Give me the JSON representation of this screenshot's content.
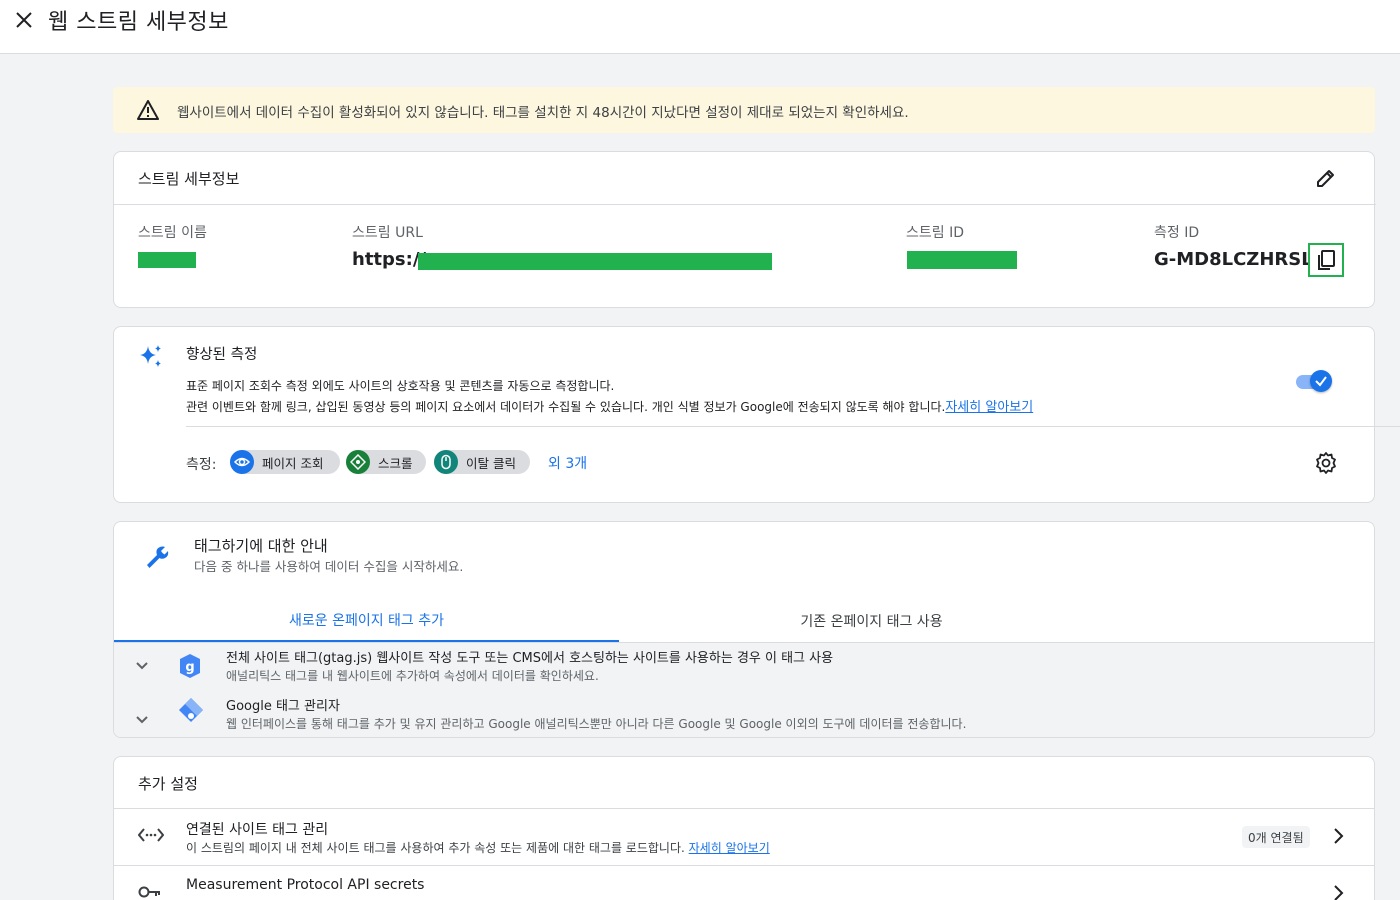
{
  "header": {
    "title": "웹 스트림 세부정보",
    "close_icon": "close-icon"
  },
  "warning": {
    "text": "웹사이트에서 데이터 수집이 활성화되어 있지 않습니다. 태그를 설치한 지 48시간이 지났다면 설정이 제대로 되었는지 확인하세요.",
    "icon": "warning-icon",
    "bg_color": "#fef7e0"
  },
  "stream_details": {
    "title": "스트림 세부정보",
    "name_label": "스트림 이름",
    "url_label": "스트림 URL",
    "url_prefix": "https://",
    "id_label": "스트림 ID",
    "measurement_label": "측정 ID",
    "measurement_id": "G-MD8LCZHRSL",
    "redaction_color": "#21b14e"
  },
  "enhanced": {
    "title": "향상된 측정",
    "desc1": "표준 페이지 조회수 측정 외에도 사이트의 상호작용 및 콘텐츠를 자동으로 측정합니다.",
    "desc2": "관련 이벤트와 함께 링크, 삽입된 동영상 등의 페이지 요소에서 데이터가 수집될 수 있습니다. 개인 식별 정보가 Google에 전송되지 않도록 해야 합니다.",
    "learn_more": "자세히 알아보기",
    "toggle_on": true,
    "measure_label": "측정:",
    "chips": [
      {
        "label": "페이지 조회",
        "icon": "eye-icon",
        "color": "#1a73e8"
      },
      {
        "label": "스크롤",
        "icon": "scroll-icon",
        "color": "#188038"
      },
      {
        "label": "이탈 클릭",
        "icon": "mouse-icon",
        "color": "#12857a"
      }
    ],
    "more": "외 3개"
  },
  "tagging": {
    "title": "태그하기에 대한 안내",
    "subtitle": "다음 중 하나를 사용하여 데이터 수집을 시작하세요.",
    "tabs": [
      "새로운 온페이지 태그 추가",
      "기존 온페이지 태그 사용"
    ],
    "options": [
      {
        "title": "전체 사이트 태그(gtag.js) 웹사이트 작성 도구 또는 CMS에서 호스팅하는 사이트를 사용하는 경우 이 태그 사용",
        "desc": "애널리틱스 태그를 내 웹사이트에 추가하여 속성에서 데이터를 확인하세요.",
        "icon": "gtag-icon"
      },
      {
        "title": "Google 태그 관리자",
        "desc": "웹 인터페이스를 통해 태그를 추가 및 유지 관리하고 Google 애널리틱스뿐만 아니라 다른 Google 및 Google 이외의 도구에 데이터를 전송합니다.",
        "icon": "tag-manager-icon"
      }
    ]
  },
  "additional": {
    "title": "추가 설정",
    "rows": [
      {
        "title": "연결된 사이트 태그 관리",
        "desc": "이 스트림의 페이지 내 전체 사이트 태그를 사용하여 추가 속성 또는 제품에 대한 태그를 로드합니다. ",
        "link": "자세히 알아보기",
        "count": "0개 연결됨",
        "icon": "code-icon"
      },
      {
        "title": "Measurement Protocol API secrets",
        "icon": "key-icon"
      }
    ]
  }
}
